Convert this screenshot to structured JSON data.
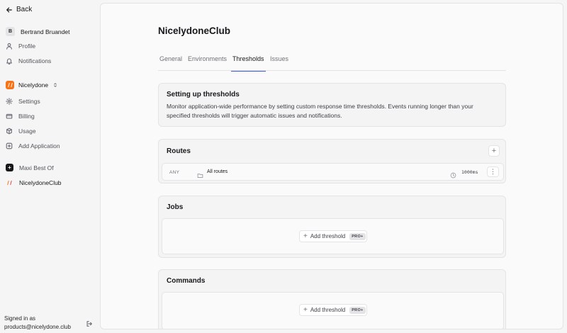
{
  "sidebar": {
    "back_label": "Back",
    "user": {
      "initial": "B",
      "name": "Bertrand Bruandet"
    },
    "user_items": [
      {
        "label": "Profile",
        "icon": "user-icon"
      },
      {
        "label": "Notifications",
        "icon": "bell-icon"
      }
    ],
    "org": {
      "name": "Nicelydone"
    },
    "org_items": [
      {
        "label": "Settings",
        "icon": "gear-icon"
      },
      {
        "label": "Billing",
        "icon": "credit-card-icon"
      },
      {
        "label": "Usage",
        "icon": "box-icon"
      },
      {
        "label": "Add Application",
        "icon": "plus-square-icon"
      }
    ],
    "apps": [
      {
        "label": "Maxi Best Of",
        "logo_glyph": "+"
      },
      {
        "label": "NicelydoneClub"
      }
    ],
    "signed_in_label": "Signed in as",
    "signed_in_email": "products@nicelydone.club"
  },
  "page": {
    "title": "NicelydoneClub",
    "tabs": [
      {
        "label": "General",
        "active": false
      },
      {
        "label": "Environments",
        "active": false
      },
      {
        "label": "Thresholds",
        "active": true
      },
      {
        "label": "Issues",
        "active": false
      }
    ],
    "intro": {
      "title": "Setting up thresholds",
      "description": "Monitor application-wide performance by setting custom response time thresholds. Events running longer than your specified thresholds will trigger automatic issues and notifications."
    },
    "routes": {
      "title": "Routes",
      "add_glyph": "+",
      "rows": [
        {
          "method": "ANY",
          "label": "All routes",
          "time": "1000ms",
          "menu_glyph": "⋮"
        }
      ]
    },
    "jobs": {
      "title": "Jobs",
      "button_label": "Add threshold",
      "badge": "PRO+"
    },
    "commands": {
      "title": "Commands",
      "button_label": "Add threshold",
      "badge": "PRO+"
    }
  },
  "colors": {
    "accent": "#3b5bdb",
    "brand_orange": "#f97316"
  }
}
